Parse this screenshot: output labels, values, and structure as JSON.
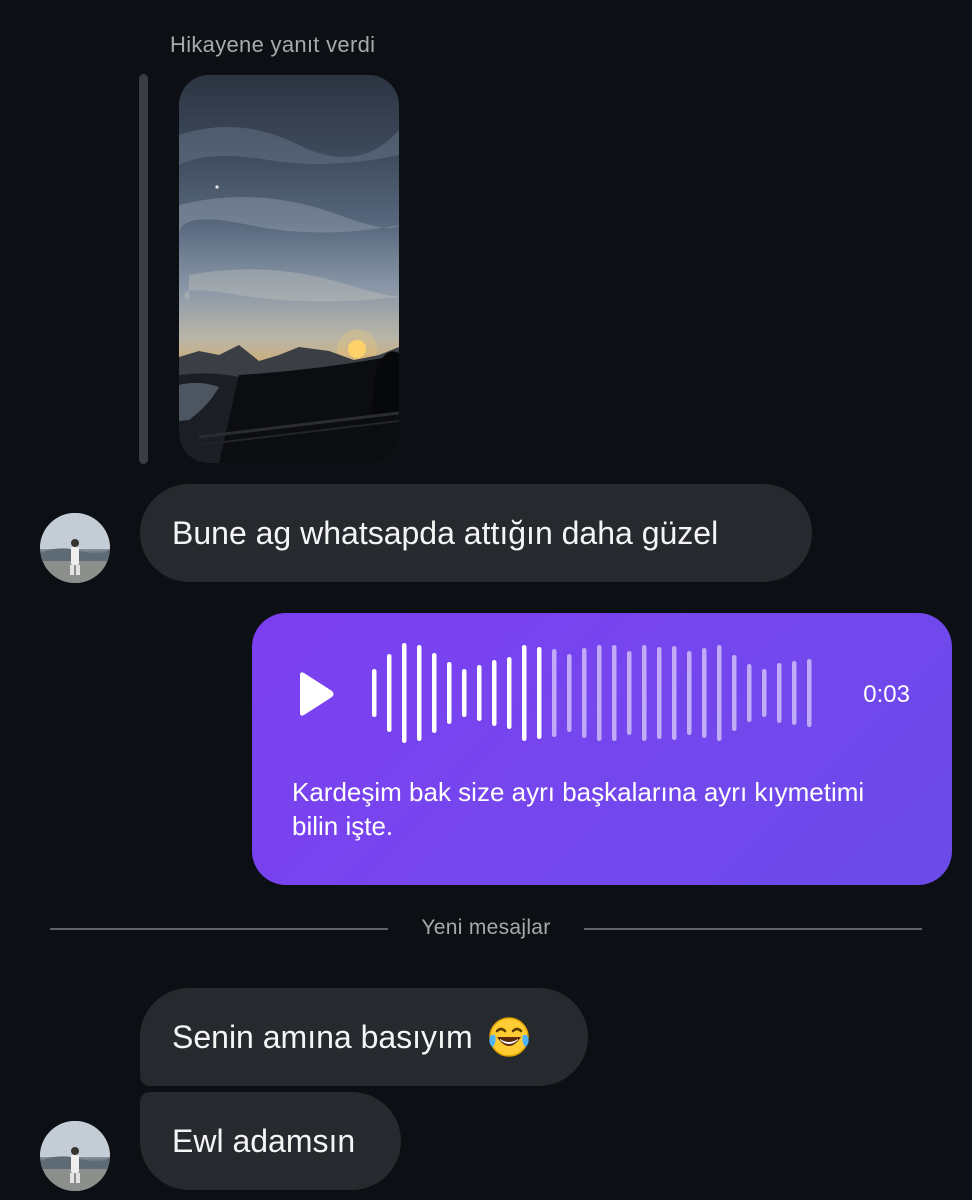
{
  "story_reply": {
    "caption": "Hikayene yanıt verdi"
  },
  "messages": {
    "incoming_1": "Bune ag whatsapda attığın daha güzel",
    "voice": {
      "duration": "0:03",
      "progress": 0.32,
      "transcript": "Kardeşim bak size ayrı başkalarına ayrı kıymetimi bilin işte."
    },
    "divider": "Yeni mesajlar",
    "incoming_2": "Senin amına basıyım",
    "incoming_2_emoji": "face-with-tears-of-joy-icon",
    "incoming_3": "Ewl adamsın"
  },
  "colors": {
    "background": "#0c1014",
    "incoming_bubble": "#262a2e",
    "outgoing_bubble": "#7c3ff0"
  }
}
